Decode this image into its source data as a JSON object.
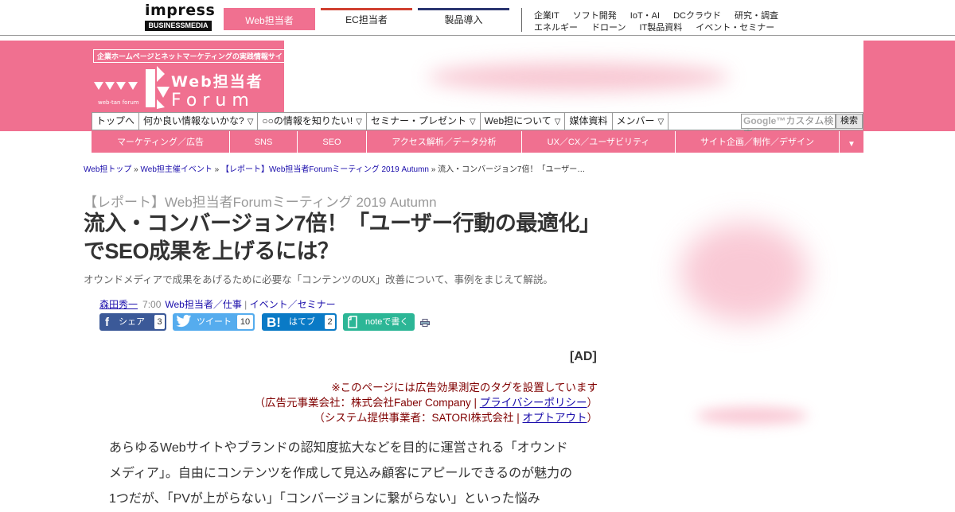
{
  "topbar": {
    "publisher_logo_word": "impress",
    "publisher_logo_sub": "BUSINESSMEDIA",
    "site_tabs": [
      "Web担当者",
      "EC担当者",
      "製品導入"
    ],
    "links_row1": [
      "企業IT",
      "ソフト開発",
      "IoT・AI",
      "DCクラウド",
      "研究・調査"
    ],
    "links_row2": [
      "エネルギー",
      "ドローン",
      "IT製品資料",
      "イベント・セミナー"
    ]
  },
  "header": {
    "tagline": "企業ホームページとネットマーケティングの実践情報サイト",
    "logo_title": "Web担当者",
    "logo_forum": "Forum",
    "logo_small": "web-tan forum"
  },
  "mainnav": {
    "items": [
      {
        "label": "トップへ",
        "arrow": ""
      },
      {
        "label": "何か良い情報ないかな?",
        "arrow": "▽"
      },
      {
        "label": "○○の情報を知りたい!",
        "arrow": "▽"
      },
      {
        "label": "セミナー・プレゼント",
        "arrow": "▽"
      },
      {
        "label": "Web担について",
        "arrow": "▽"
      },
      {
        "label": "媒体資料",
        "arrow": ""
      },
      {
        "label": "メンバー",
        "arrow": "▽"
      }
    ],
    "search_placeholder_brand": "Google™",
    "search_placeholder_text": "カスタム検索",
    "search_button": "検索"
  },
  "subnav": {
    "items": [
      "マーケティング／広告",
      "SNS",
      "SEO",
      "アクセス解析／データ分析",
      "UX／CX／ユーザビリティ",
      "サイト企画／制作／デザイン"
    ],
    "more": "▼"
  },
  "breadcrumb": {
    "items": [
      "Web担トップ",
      "Web担主催イベント",
      "【レポート】Web担当者Forumミーティング 2019 Autumn"
    ],
    "current": "流入・コンバージョン7倍！「ユーザー…",
    "sep": " » "
  },
  "article": {
    "kicker": "【レポート】Web担当者Forumミーティング 2019 Autumn",
    "title": "流入・コンバージョン7倍！「ユーザー行動の最適化」でSEO成果を上げるには？",
    "lede": "オウンドメディアで成果をあげるために必要な「コンテンツのUX」改善について、事例をまじえて解説。",
    "author": "森田秀一",
    "time": "7:00",
    "category_1": "Web担当者／仕事",
    "category_sep": " | ",
    "category_2": "イベント／セミナー"
  },
  "share": {
    "facebook": {
      "icon": "f",
      "label": "シェア",
      "count": "3"
    },
    "twitter": {
      "label": "ツイート",
      "count": "10"
    },
    "hatena": {
      "icon": "B!",
      "label": "はてブ",
      "count": "2"
    },
    "note": {
      "label": "noteで書く"
    }
  },
  "ad": {
    "label": "[AD]",
    "notice_line1": "※このページには広告効果測定のタグを設置しています",
    "notice_line2_pre": "（広告元事業会社：株式会社Faber Company | ",
    "notice_line2_link": "プライバシーポリシー",
    "notice_line2_post": "）",
    "notice_line3_pre": "（システム提供事業者：SATORI株式会社 | ",
    "notice_line3_link": "オプトアウト",
    "notice_line3_post": "）"
  },
  "body": {
    "paragraph_1": "あらゆるWebサイトやブランドの認知度拡大などを目的に運営される「オウンドメディア」。自由にコンテンツを作成して見込み顧客にアピールできるのが魅力の1つだが、「PVが上がらない」「コンバージョンに繋がらない」といった悩み"
  },
  "colors": {
    "brand_pink": "#f07090",
    "ec_accent": "#d04030",
    "product_accent": "#2a3570",
    "facebook": "#3b5998",
    "twitter": "#55acee",
    "hatena": "#0a7ac6",
    "note": "#2cb696"
  }
}
